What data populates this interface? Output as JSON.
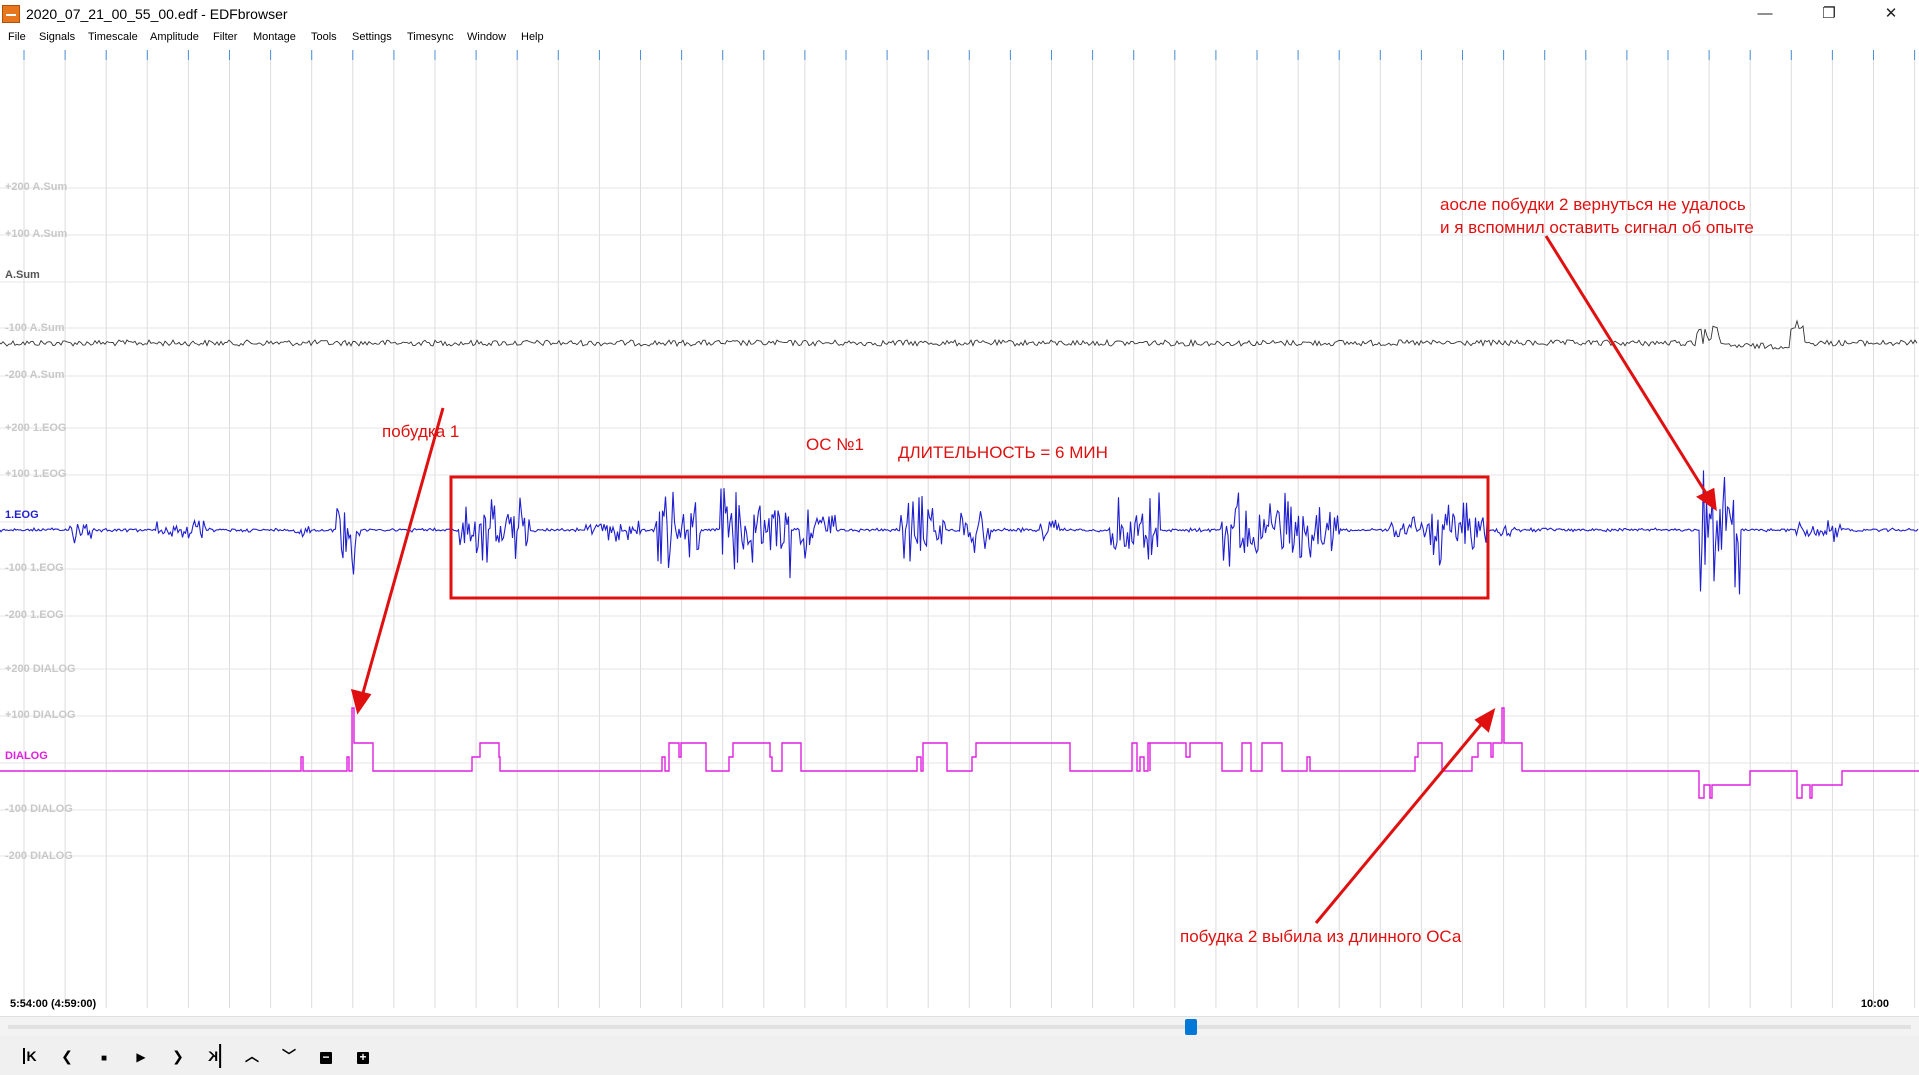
{
  "window": {
    "title": "2020_07_21_00_55_00.edf - EDFbrowser",
    "minimize": "—",
    "maximize": "❐",
    "close": "✕"
  },
  "menu": [
    "File",
    "Signals",
    "Timescale",
    "Amplitude",
    "Filter",
    "Montage",
    "Tools",
    "Settings",
    "Timesync",
    "Window",
    "Help"
  ],
  "channels": {
    "asum": {
      "name": "A.Sum",
      "color": "#333333",
      "labels": [
        "+200 A.Sum",
        "+100 A.Sum",
        "-100 A.Sum",
        "-200 A.Sum"
      ]
    },
    "eog": {
      "name": "1.EOG",
      "color": "#1f1fd0",
      "labels": [
        "+200 1.EOG",
        "+100 1.EOG",
        "-100 1.EOG",
        "-200 1.EOG"
      ]
    },
    "dialog": {
      "name": "DIALOG",
      "color": "#e020e0",
      "labels": [
        "+200 DIALOG",
        "+100 DIALOG",
        "-100 DIALOG",
        "-200 DIALOG"
      ]
    }
  },
  "annotations": {
    "wake1": "побудка 1",
    "os1": "ОС №1",
    "duration": "ДЛИТЕЛЬНОСТЬ = 6 МИН",
    "after_wake2_line1": "аосле побудки 2 вернуться не удалось",
    "after_wake2_line2": "и я вспомнил оставить сигнал об опыте",
    "wake2": "побудка 2 выбила из длинного ОСа"
  },
  "status": {
    "left": "5:54:00 (4:59:00)",
    "right": "10:00"
  },
  "scroll": {
    "position_fraction": 0.625
  },
  "toolbar": {
    "first": "K",
    "prev": "❮",
    "stop": "■",
    "play": "▶",
    "next": "❯",
    "last": "K",
    "up": "︿",
    "down": "﹀",
    "minus": "−",
    "plus": "+"
  },
  "colors": {
    "annotation": "#e01010",
    "grid": "#d8d8d8",
    "accent": "#0078d7"
  }
}
